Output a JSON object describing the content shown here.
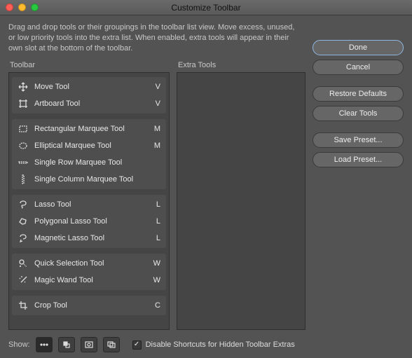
{
  "window": {
    "title": "Customize Toolbar"
  },
  "instructions": "Drag and drop tools or their groupings in the toolbar list view. Move excess, unused, or low priority tools into the extra list. When enabled, extra tools will appear in their own slot at the bottom of the toolbar.",
  "columns": {
    "toolbar": "Toolbar",
    "extra": "Extra Tools"
  },
  "groups": [
    {
      "tools": [
        {
          "icon": "move",
          "name": "Move Tool",
          "key": "V"
        },
        {
          "icon": "artboard",
          "name": "Artboard Tool",
          "key": "V"
        }
      ]
    },
    {
      "tools": [
        {
          "icon": "rect-marquee",
          "name": "Rectangular Marquee Tool",
          "key": "M"
        },
        {
          "icon": "ellipse-marquee",
          "name": "Elliptical Marquee Tool",
          "key": "M"
        },
        {
          "icon": "row-marquee",
          "name": "Single Row Marquee Tool",
          "key": ""
        },
        {
          "icon": "col-marquee",
          "name": "Single Column Marquee Tool",
          "key": ""
        }
      ]
    },
    {
      "tools": [
        {
          "icon": "lasso",
          "name": "Lasso Tool",
          "key": "L"
        },
        {
          "icon": "poly-lasso",
          "name": "Polygonal Lasso Tool",
          "key": "L"
        },
        {
          "icon": "mag-lasso",
          "name": "Magnetic Lasso Tool",
          "key": "L"
        }
      ]
    },
    {
      "tools": [
        {
          "icon": "quick-sel",
          "name": "Quick Selection Tool",
          "key": "W"
        },
        {
          "icon": "wand",
          "name": "Magic Wand Tool",
          "key": "W"
        }
      ]
    },
    {
      "tools": [
        {
          "icon": "crop",
          "name": "Crop Tool",
          "key": "C"
        }
      ]
    }
  ],
  "buttons": {
    "done": "Done",
    "cancel": "Cancel",
    "restore": "Restore Defaults",
    "clear": "Clear Tools",
    "save": "Save Preset...",
    "load": "Load Preset..."
  },
  "footer": {
    "show": "Show:",
    "checkbox": "Disable Shortcuts for Hidden Toolbar Extras"
  }
}
